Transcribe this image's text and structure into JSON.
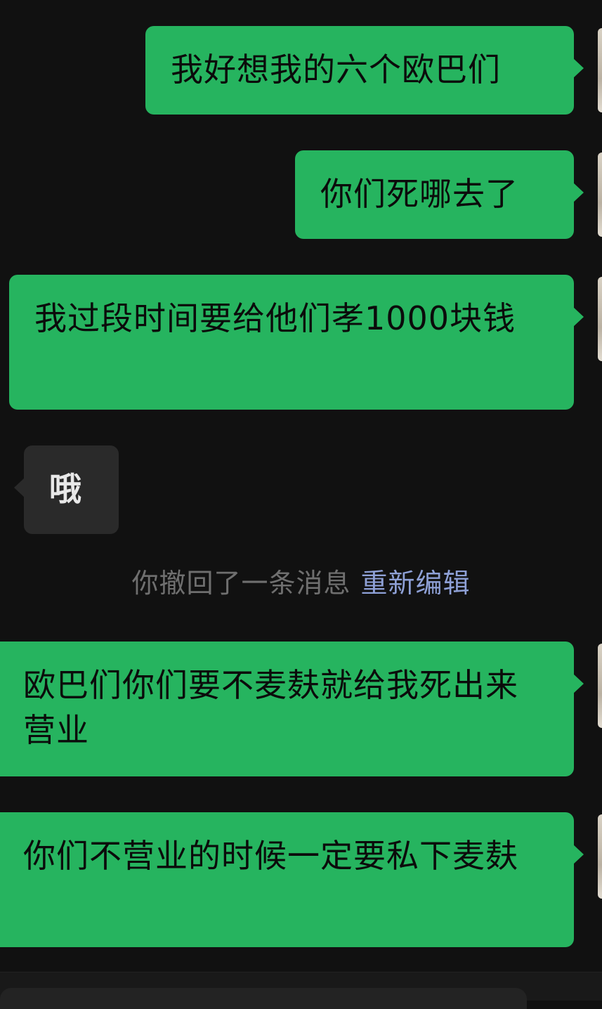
{
  "messages": [
    {
      "direction": "out",
      "text": "我好想我的六个欧巴们"
    },
    {
      "direction": "out",
      "text": "你们死哪去了"
    },
    {
      "direction": "out",
      "text": "我过段时间要给他们孝1000块钱"
    },
    {
      "direction": "in",
      "text": "哦"
    },
    {
      "direction": "out",
      "text": "欧巴们你们要不麦麸就给我死出来营业"
    },
    {
      "direction": "out",
      "text": "你们不营业的时候一定要私下麦麸"
    }
  ],
  "system_notice": {
    "text": "你撤回了一条消息",
    "action": "重新编辑"
  },
  "colors": {
    "background": "#111111",
    "outgoing_bubble": "#26b45f",
    "incoming_bubble": "#2a2a2a",
    "system_text": "#6f6f6f",
    "link": "#8ea0d6"
  }
}
